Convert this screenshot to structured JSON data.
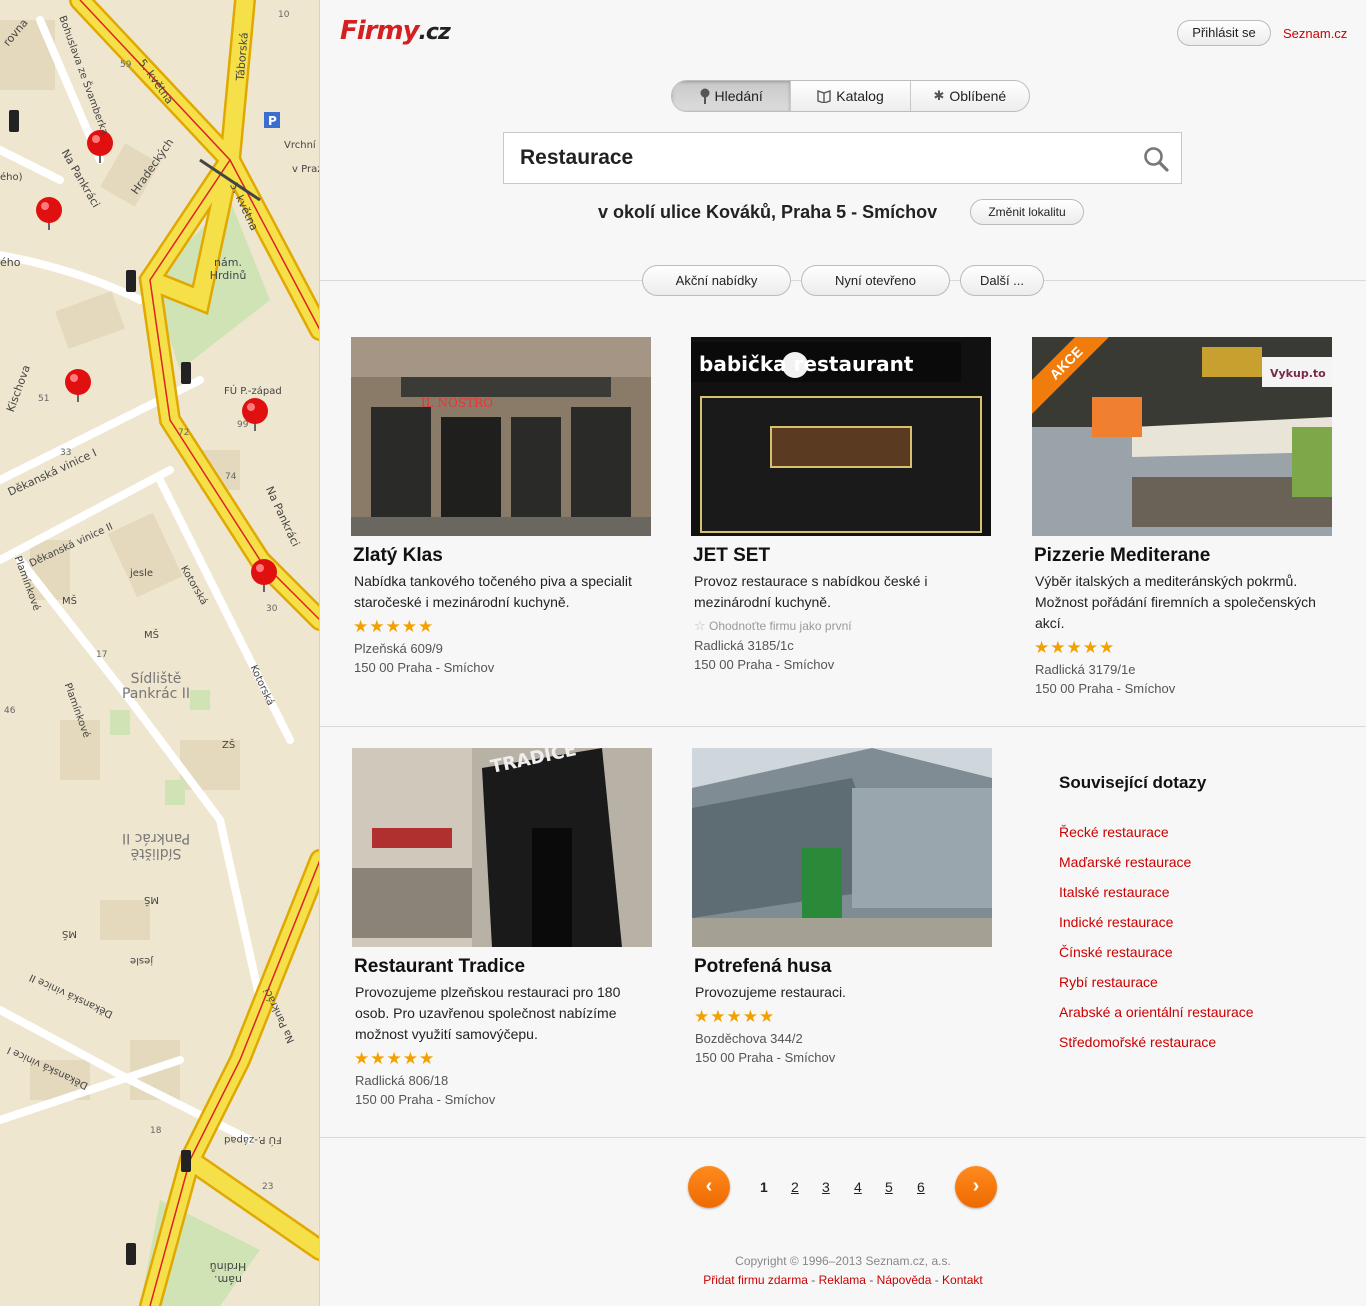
{
  "map": {
    "streets": [
      "5. května",
      "Táborská",
      "Bohuslava ze Švamberka",
      "Na Pankráci",
      "Hradeckých",
      "nám. Hrdinů",
      "Děkanská vinice I",
      "Děkanská vinice II",
      "Kischova",
      "Plamínkové",
      "Kotorská",
      "Vrchní zastupit",
      "v Praz",
      "FÚ P.-západ",
      "Sídliště Pankrác II",
      "ZŠ",
      "MŠ",
      "jesle",
      "ého",
      "rovna",
      "ého)"
    ],
    "numbers": [
      "10",
      "99",
      "23",
      "72",
      "74",
      "33",
      "30",
      "46",
      "51",
      "59",
      "17",
      "18"
    ]
  },
  "header": {
    "logo_main": "Firmy",
    "logo_tld": ".cz",
    "login_label": "Přihlásit se",
    "seznam_link": "Seznam.cz"
  },
  "tabs": [
    {
      "label": "Hledání",
      "icon": "pin-icon"
    },
    {
      "label": "Katalog",
      "icon": "book-icon"
    },
    {
      "label": "Oblíbené",
      "icon": "star-icon"
    }
  ],
  "search": {
    "value": "Restaurace"
  },
  "locality": {
    "text": "v okolí ulice Kováků, Praha 5 - Smíchov",
    "change_label": "Změnit lokalitu"
  },
  "filters": [
    "Akční nabídky",
    "Nyní otevřeno",
    "Další ..."
  ],
  "results": [
    {
      "title": "Zlatý Klas",
      "desc": "Nabídka tankového točeného piva a specialit staročeské i mezinárodní kuchyně.",
      "stars": "★★★★★",
      "street": "Plzeňská 609/9",
      "city": "150 00  Praha - Smíchov"
    },
    {
      "title": "JET SET",
      "desc": "Provoz restaurace s nabídkou české i mezinárodní kuchyně.",
      "rate_first": "Ohodnoťte firmu jako první",
      "street": "Radlická 3185/1c",
      "city": "150 00  Praha - Smíchov"
    },
    {
      "title": "Pizzerie Mediterane",
      "desc": "Výběr italských a mediteránských pokrmů. Možnost pořádání firemních a společenských akcí.",
      "stars": "★★★★★",
      "street": "Radlická 3179/1e",
      "city": "150 00  Praha - Smíchov",
      "badge": "AKCE"
    },
    {
      "title": "Restaurant Tradice",
      "desc": "Provozujeme plzeňskou restauraci pro 180 osob. Pro uzavřenou společnost nabízíme možnost využití samovýčepu.",
      "stars": "★★★★★",
      "street": "Radlická 806/18",
      "city": "150 00  Praha - Smíchov"
    },
    {
      "title": "Potrefená husa",
      "desc": "Provozujeme restauraci.",
      "stars": "★★★★★",
      "street": "Bozděchova 344/2",
      "city": "150 00  Praha - Smíchov"
    }
  ],
  "image_signs": {
    "zlaty_klas": "IL NOSTRO",
    "jetset": "babička restaurant",
    "pizzerie": "Vykup.to",
    "tradice": "TRADICE"
  },
  "related": {
    "title": "Související dotazy",
    "links": [
      "Řecké restaurace",
      "Maďarské restaurace",
      "Italské restaurace",
      "Indické restaurace",
      "Čínské restaurace",
      "Rybí restaurace",
      "Arabské a orientální restaurace",
      "Středomořské restaurace"
    ]
  },
  "pagination": {
    "prev": "‹",
    "next": "›",
    "pages": [
      "1",
      "2",
      "3",
      "4",
      "5",
      "6"
    ],
    "current": "1"
  },
  "footer": {
    "copyright": "Copyright © 1996–2013 Seznam.cz, a.s.",
    "links": [
      "Přidat firmu zdarma",
      "Reklama",
      "Nápověda",
      "Kontakt"
    ],
    "separator": " - "
  },
  "colors": {
    "accent": "#cc0000",
    "orange": "#f07c0c",
    "star": "#f2a100",
    "road_yellow": "#f6e04a"
  }
}
